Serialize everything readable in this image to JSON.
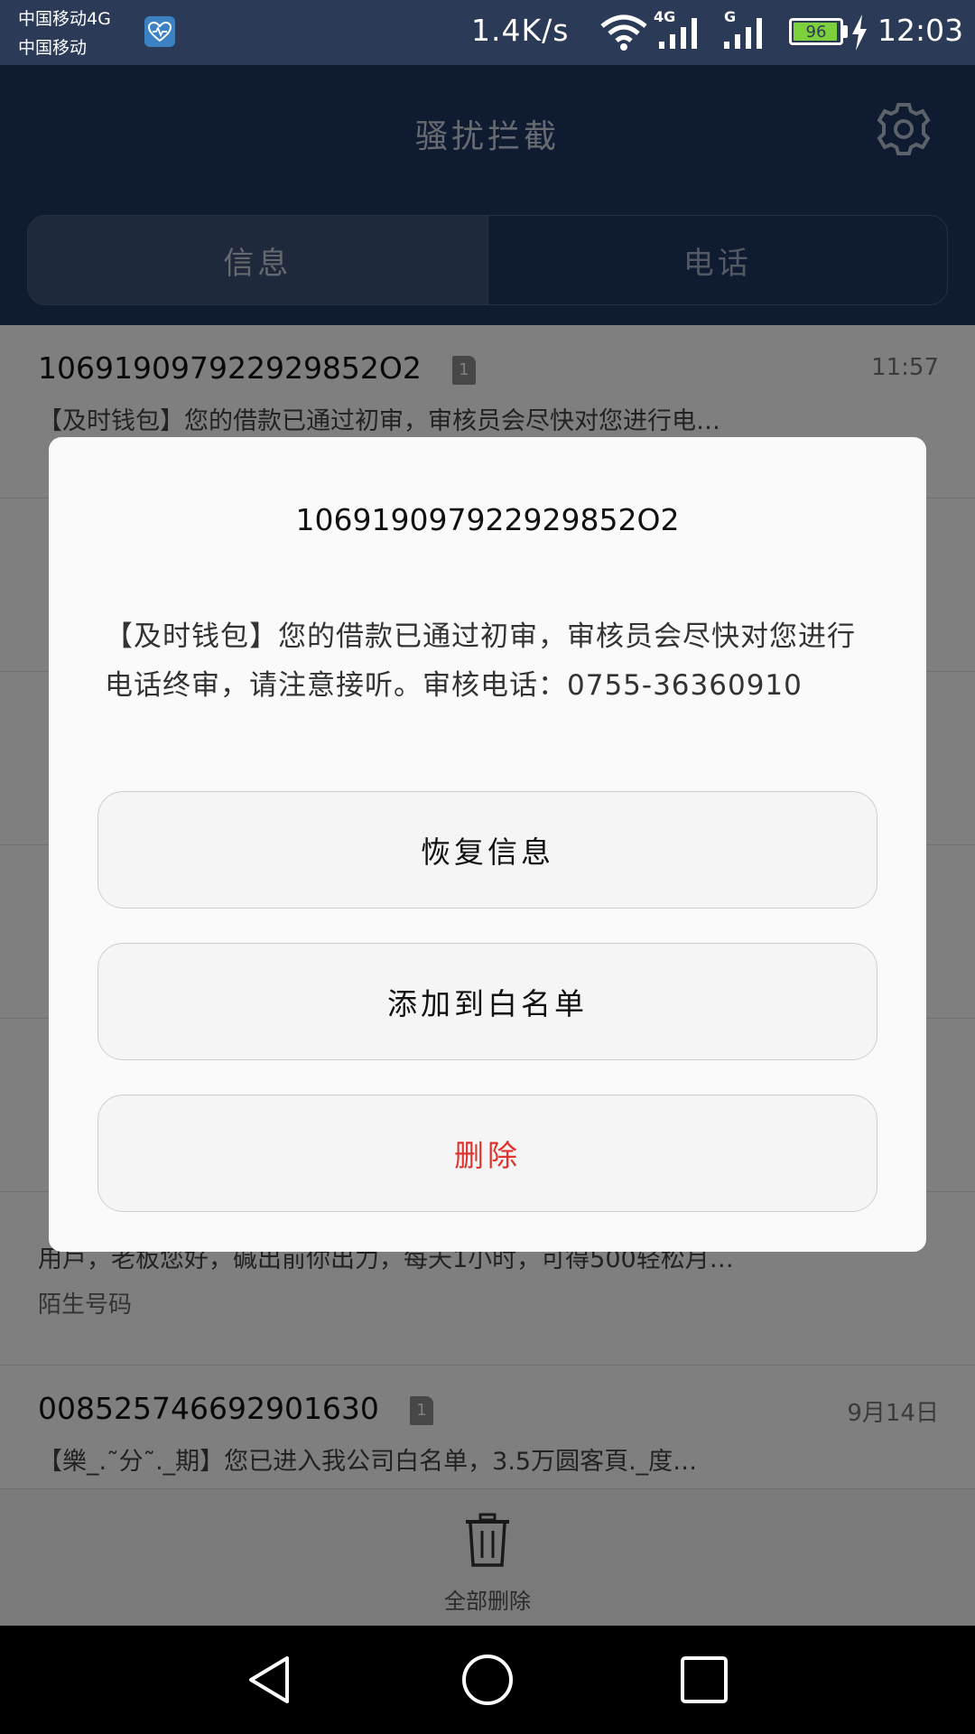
{
  "status_bar": {
    "carrier_1": "中国移动4G",
    "carrier_2": "中国移动",
    "net_speed": "1.4K/s",
    "sig1_label": "4G",
    "sig2_label": "G",
    "battery_level": "96",
    "time": "12:03",
    "battery_color": "#7bd03b"
  },
  "header": {
    "title": "骚扰拦截",
    "settings_icon": "gear-icon",
    "tabs": [
      {
        "label": "信息",
        "active": true
      },
      {
        "label": "电话",
        "active": false
      }
    ]
  },
  "list": {
    "items": [
      {
        "sender": "106919097922929852O2",
        "sim": "1",
        "time": "11:57",
        "preview": "【及时钱包】您的借款已通过初审，审核员会尽快对您进行电…"
      },
      {
        "sender": "",
        "time": "",
        "preview": "",
        "tag": ""
      },
      {
        "sender": "",
        "time": "",
        "preview": "",
        "tag": ""
      },
      {
        "sender": "",
        "time": "",
        "preview": "",
        "tag": ""
      },
      {
        "sender": "",
        "time": "",
        "preview": "",
        "tag": ""
      },
      {
        "sender": "",
        "time": "",
        "preview": "用戶，老板您好，碱出前你出力，每天1小时，可得500轻松月…",
        "tag": "陌生号码"
      },
      {
        "sender": "008525746692901630",
        "sim": "1",
        "time": "9月14日",
        "preview": "【樂_.˜分˜._期】您已进入我公司白名单，3.5万圆客頁._度…"
      }
    ]
  },
  "footer": {
    "delete_all_label": "全部删除",
    "icon": "trash-icon"
  },
  "dialog": {
    "sender": "106919097922929852O2",
    "message": "【及时钱包】您的借款已通过初审，审核员会尽快对您进行电话终审，请注意接听。审核电话：0755-36360910",
    "buttons": {
      "restore": "恢复信息",
      "whitelist": "添加到白名单",
      "delete": "删除"
    },
    "delete_color": "#e0332d"
  },
  "navbar": {
    "back_icon": "back-triangle-icon",
    "home_icon": "home-circle-icon",
    "recent_icon": "recent-square-icon"
  }
}
